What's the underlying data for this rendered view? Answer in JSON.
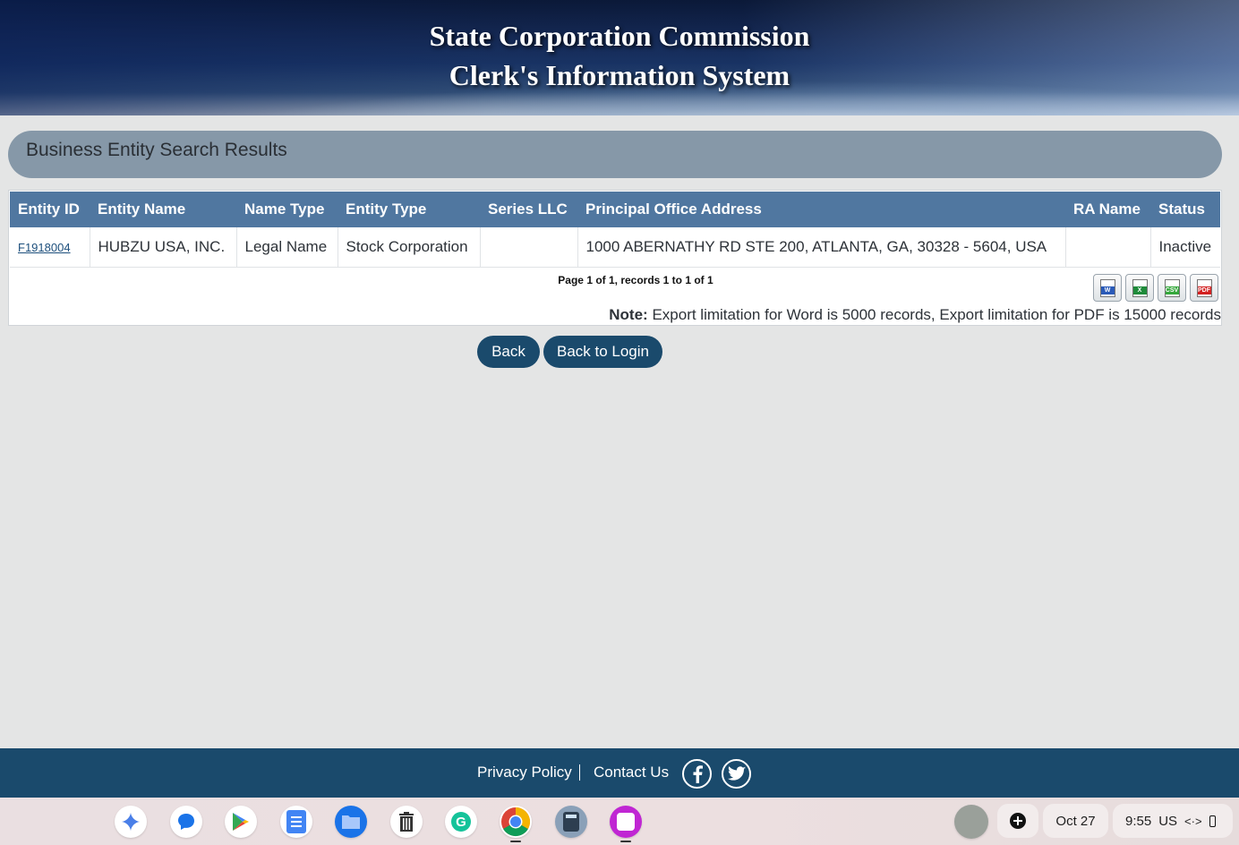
{
  "banner": {
    "line1": "State Corporation Commission",
    "line2": "Clerk's Information System"
  },
  "results": {
    "title": "Business Entity Search Results",
    "columns": [
      "Entity ID",
      "Entity Name",
      "Name Type",
      "Entity Type",
      "Series LLC",
      "Principal Office Address",
      "RA Name",
      "Status"
    ],
    "rows": [
      {
        "entity_id": "F1918004",
        "entity_name": "HUBZU USA, INC.",
        "name_type": "Legal Name",
        "entity_type": "Stock Corporation",
        "series_llc": "",
        "address": "1000 ABERNATHY RD STE 200, ATLANTA, GA, 30328 - 5604, USA",
        "ra_name": "",
        "status": "Inactive"
      }
    ],
    "pager": "Page 1 of 1, records 1 to 1 of 1",
    "note_label": "Note:",
    "note_text": " Export limitation for Word is 5000 records, Export limitation for PDF is 15000 records",
    "exports": [
      {
        "icon": "word-export-icon",
        "label": "W"
      },
      {
        "icon": "excel-export-icon",
        "label": "X"
      },
      {
        "icon": "csv-export-icon",
        "label": "CSV"
      },
      {
        "icon": "pdf-export-icon",
        "label": "PDF"
      }
    ]
  },
  "buttons": {
    "back": "Back",
    "back_to_login": "Back to Login"
  },
  "footer": {
    "privacy": "Privacy Policy",
    "contact": "Contact Us",
    "social": [
      "facebook-icon",
      "twitter-icon"
    ]
  },
  "shelf": {
    "apps": [
      "gemini-icon",
      "messages-icon",
      "play-store-icon",
      "docs-icon",
      "files-icon",
      "trash-icon",
      "grammarly-icon",
      "chrome-icon",
      "calculator-icon",
      "canvas-icon"
    ],
    "date": "Oct 27",
    "time": "9:55",
    "locale": "US"
  },
  "colors": {
    "header_row": "#5077a0",
    "button": "#1a4a6c",
    "results_bar": "#8698a8"
  }
}
